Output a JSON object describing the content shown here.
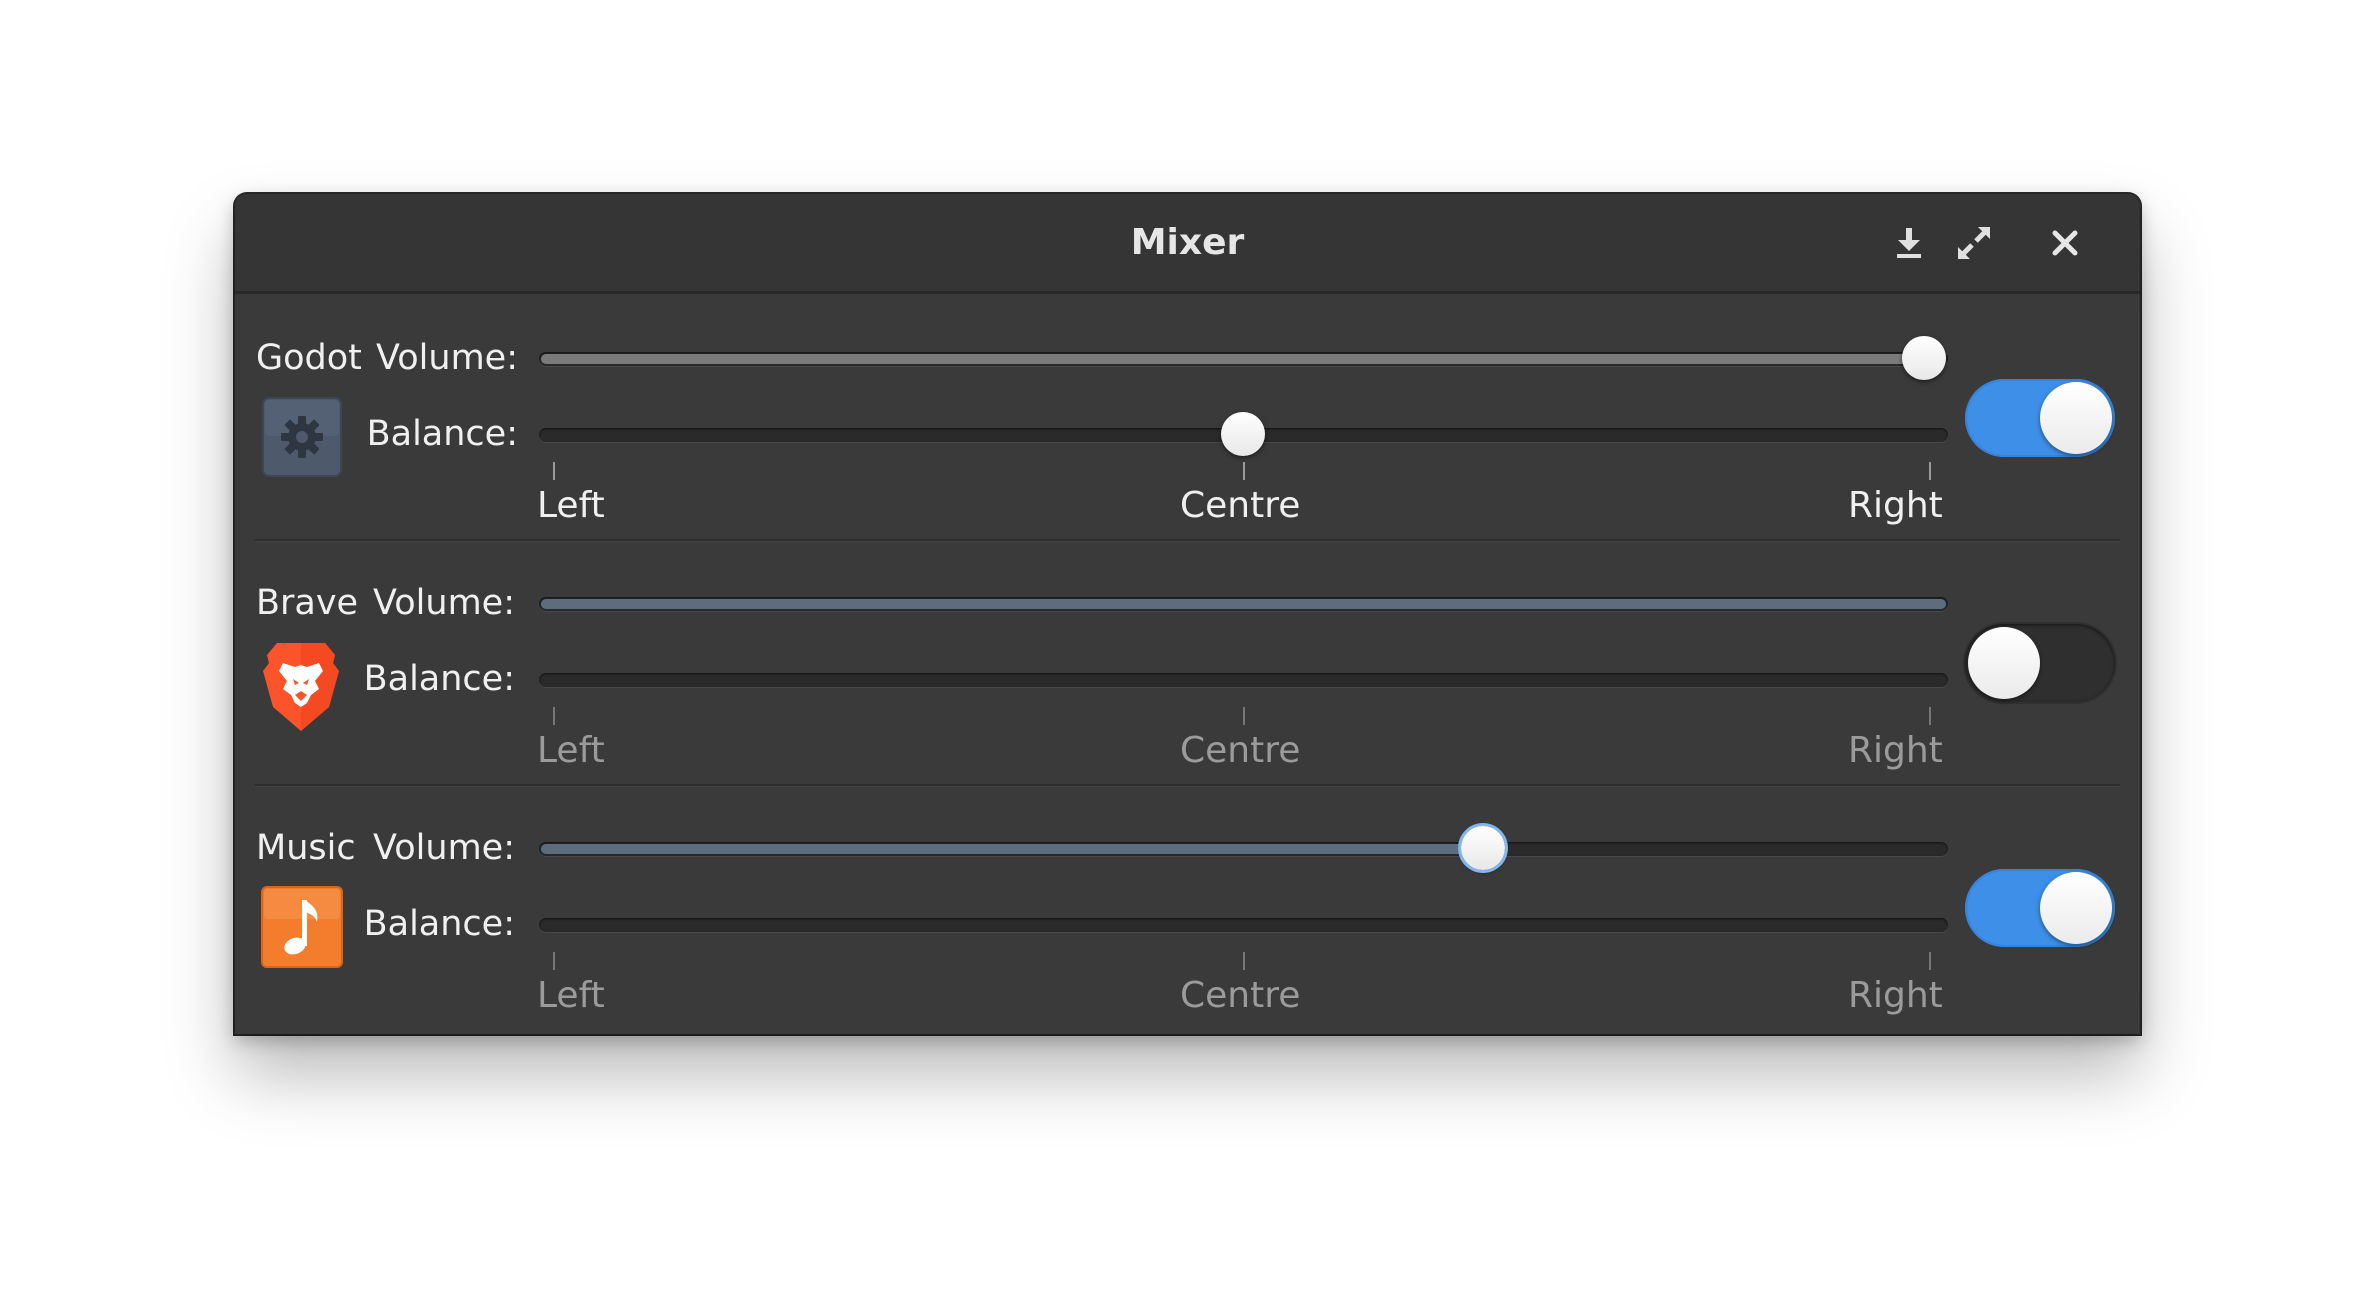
{
  "window": {
    "title": "Mixer",
    "buttons": {
      "download_icon": "download-icon",
      "maximize_icon": "maximize-icon",
      "close_icon": "close-icon"
    }
  },
  "labels": {
    "volume": "Volume:",
    "balance": "Balance:",
    "left": "Left",
    "centre": "Centre",
    "right": "Right"
  },
  "apps": [
    {
      "name": "Godot",
      "icon": "gear-icon",
      "volume": 1.0,
      "balance": 0.5,
      "enabled": true
    },
    {
      "name": "Brave",
      "icon": "brave-lion-icon",
      "volume": 1.0,
      "balance": null,
      "enabled": false
    },
    {
      "name": "Music",
      "icon": "music-note-icon",
      "volume": 0.67,
      "balance": null,
      "enabled": true
    }
  ],
  "colors": {
    "accent": "#3e8fe8",
    "window_bg": "#3a3a3a",
    "titlebar_bg": "#353535",
    "brave_orange": "#fb542b",
    "music_orange": "#f37d2c"
  }
}
